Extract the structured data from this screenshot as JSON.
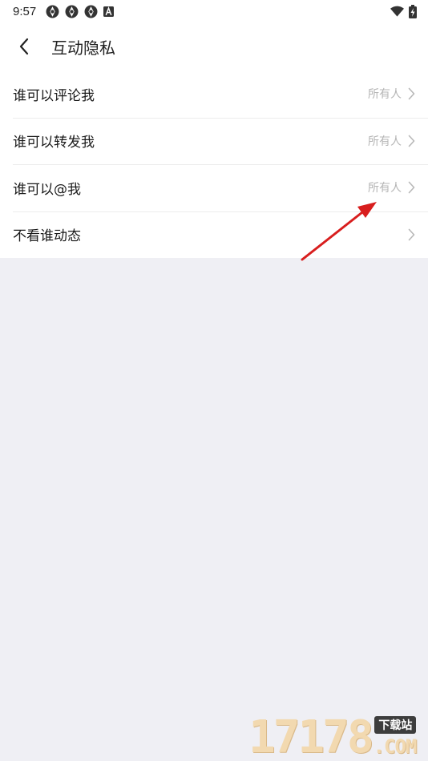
{
  "status_bar": {
    "time": "9:57",
    "left_icons": [
      "aperture-icon",
      "aperture-icon",
      "aperture-icon",
      "app-a-icon"
    ],
    "right_icons": [
      "wifi-icon",
      "battery-charging-icon"
    ]
  },
  "app_bar": {
    "back_icon": "chevron-left-icon",
    "title": "互动隐私"
  },
  "settings": {
    "items": [
      {
        "label": "谁可以评论我",
        "value": "所有人"
      },
      {
        "label": "谁可以转发我",
        "value": "所有人"
      },
      {
        "label": "谁可以@我",
        "value": "所有人"
      },
      {
        "label": "不看谁动态",
        "value": ""
      }
    ]
  },
  "annotation": {
    "type": "red-arrow",
    "color": "#d81e1e"
  },
  "watermark": {
    "digits": "17178",
    "badge": "下载站",
    "suffix": ".COM"
  },
  "colors": {
    "background": "#efeff4",
    "surface": "#ffffff",
    "text_primary": "#1a1a1a",
    "text_secondary": "#b5b5b5"
  }
}
